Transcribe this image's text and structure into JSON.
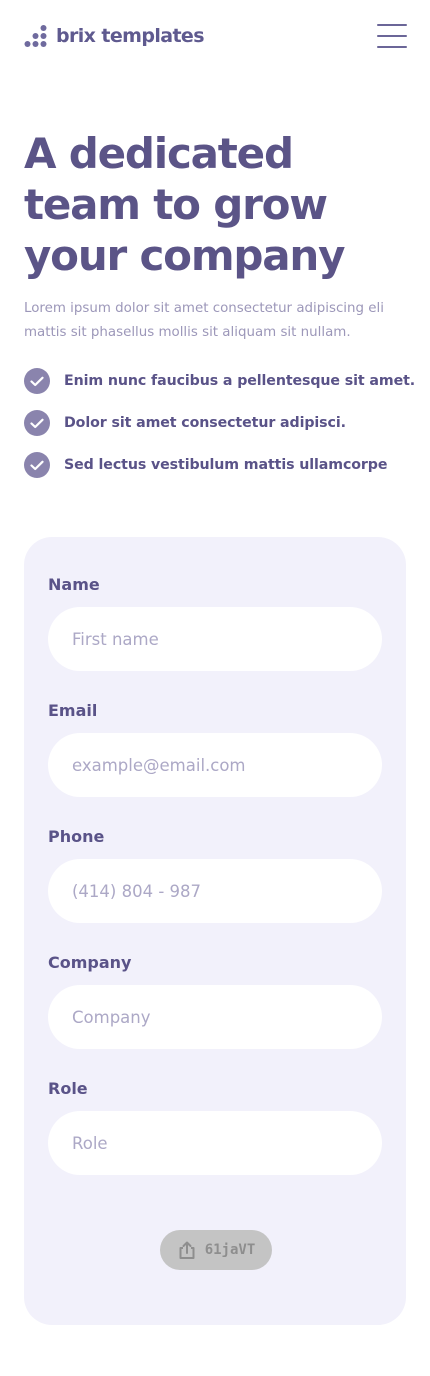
{
  "header": {
    "logo_text": "brix templates",
    "menu_icon": "hamburger-menu-icon"
  },
  "hero": {
    "title": "A dedicated team to grow your company",
    "description": "Lorem ipsum dolor sit amet consectetur adipiscing eli mattis sit phasellus mollis sit aliquam sit nullam."
  },
  "checklist": [
    {
      "text": "Enim nunc faucibus a pellentesque sit amet.",
      "icon": "check-circle-icon"
    },
    {
      "text": "Dolor sit amet consectetur adipisci.",
      "icon": "check-circle-icon"
    },
    {
      "text": "Sed lectus vestibulum mattis ullamcorpe",
      "icon": "check-circle-icon"
    }
  ],
  "form": {
    "fields": [
      {
        "label": "Name",
        "placeholder": "First name"
      },
      {
        "label": "Email",
        "placeholder": "example@email.com"
      },
      {
        "label": "Phone",
        "placeholder": "(414) 804 - 987"
      },
      {
        "label": "Company",
        "placeholder": "Company"
      },
      {
        "label": "Role",
        "placeholder": "Role"
      }
    ],
    "submit": {
      "label": "61jaVT",
      "icon": "share-upload-icon"
    }
  },
  "colors": {
    "primary": "#5a5388",
    "card_background": "#f2f1fb",
    "check_badge": "#8a84ad",
    "placeholder": "#aca8c6",
    "button_background": "#c4c4c4"
  }
}
